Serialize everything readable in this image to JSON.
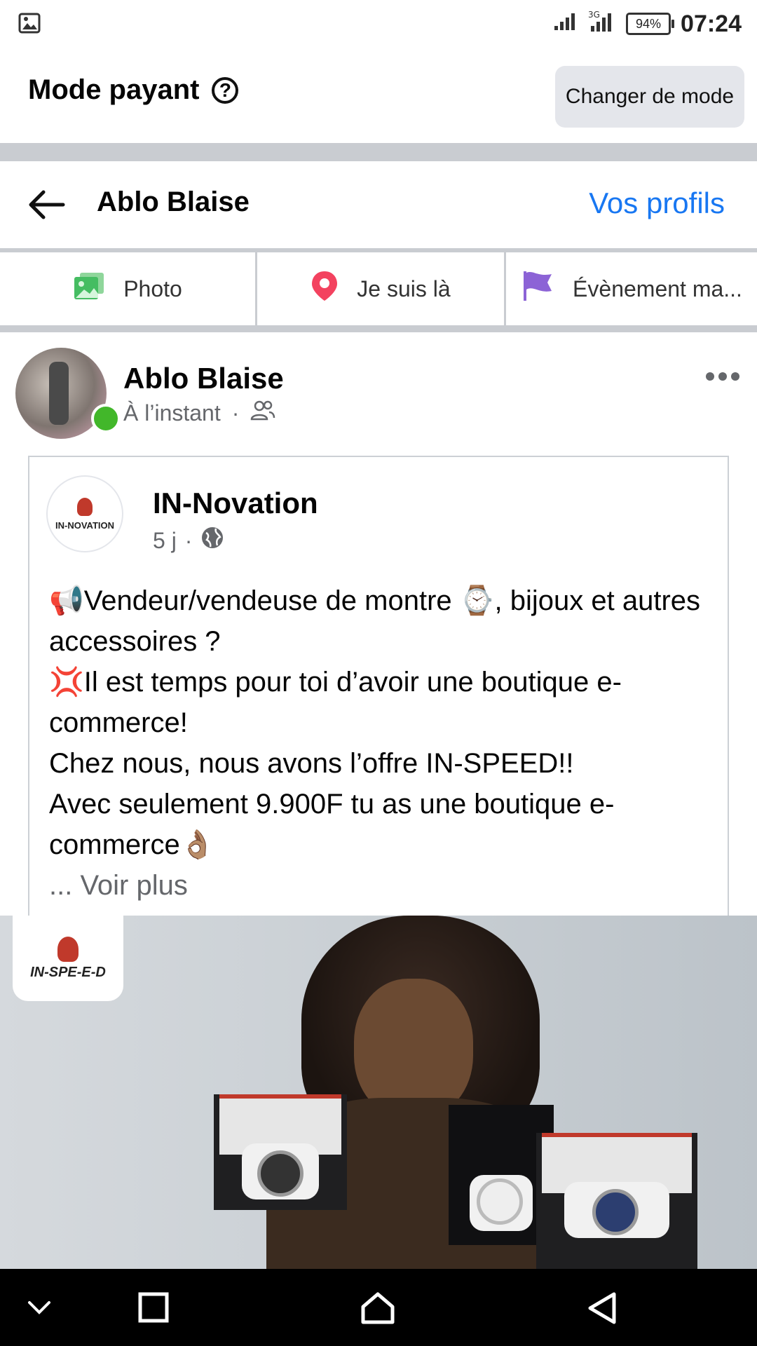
{
  "status_bar": {
    "battery": "94%",
    "time": "07:24",
    "network": "3G"
  },
  "mode_header": {
    "title": "Mode payant",
    "change_button": "Changer de mode"
  },
  "profile_bar": {
    "name": "Ablo Blaise",
    "profiles_link": "Vos profils"
  },
  "actions": [
    {
      "label": "Photo",
      "icon": "photo-icon",
      "color": "#45bd62"
    },
    {
      "label": "Je suis là",
      "icon": "location-pin-icon",
      "color": "#f3425f"
    },
    {
      "label": "Évènement ma...",
      "icon": "flag-icon",
      "color": "#8c63d6"
    }
  ],
  "post": {
    "author": "Ablo Blaise",
    "time": "À l’instant",
    "privacy_icon": "friends-icon"
  },
  "shared_post": {
    "page_name": "IN-Novation",
    "logo_text": "IN-NOVATION",
    "time": "5 j",
    "privacy_icon": "globe-icon",
    "lines": [
      "📢Vendeur/vendeuse de montre ⌚, bijoux et autres accessoires ?",
      "💢Il est temps pour toi d’avoir une boutique e-commerce!",
      "Chez nous, nous avons l’offre IN-SPEED!!",
      "Avec seulement 9.900F tu as une boutique e-commerce👌🏽"
    ],
    "see_more": "... Voir plus"
  },
  "image": {
    "badge_text": "IN-SPE-E-D",
    "alt": "watch boxes"
  },
  "colors": {
    "accent": "#1877f2",
    "online": "#42b72a",
    "secondary_text": "#65676b"
  }
}
